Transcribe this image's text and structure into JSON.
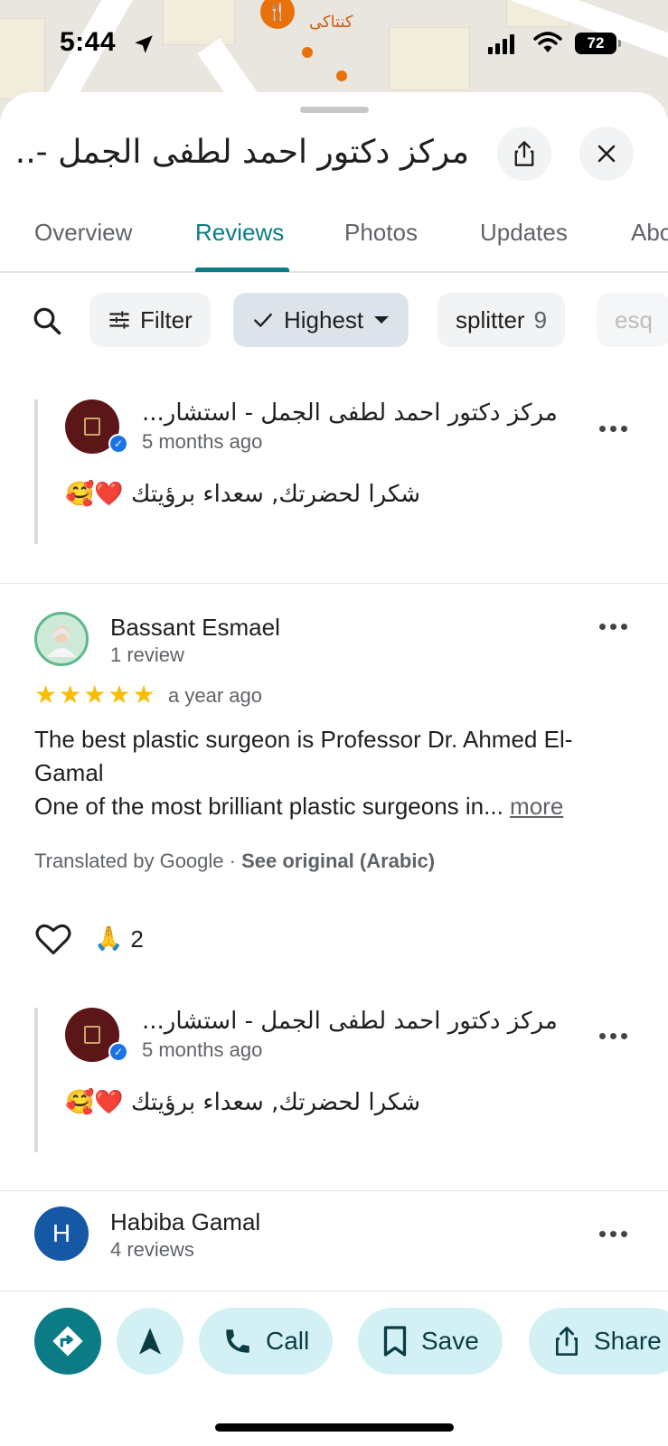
{
  "status_bar": {
    "time": "5:44",
    "battery": "72"
  },
  "map": {
    "poi_label": "كنتاكى"
  },
  "place": {
    "title": "مركز دكتور احمد لطفى الجمل -..."
  },
  "tabs": [
    {
      "label": "Overview"
    },
    {
      "label": "Reviews",
      "active": true
    },
    {
      "label": "Photos"
    },
    {
      "label": "Updates"
    },
    {
      "label": "Abo"
    }
  ],
  "filters": {
    "filter_label": "Filter",
    "sort_label": "Highest",
    "topics": [
      {
        "label": "splitter",
        "count": "9"
      },
      {
        "label": "esq"
      }
    ]
  },
  "reviews": [
    {
      "type": "owner_reply",
      "name": "مركز دكتور احمد لطفى الجمل - استشار...",
      "time": "5 months ago",
      "text": "شكرا لحضرتك, سعداء برؤيتك ❤️🥰"
    },
    {
      "type": "review",
      "name": "Bassant Esmael",
      "subtitle": "1 review",
      "rating": 5,
      "time": "a year ago",
      "text_line1": "The best plastic surgeon is Professor Dr. Ahmed El-Gamal",
      "text_line2": "One of the most brilliant plastic surgeons in...",
      "more_label": "more",
      "translated": "Translated by Google · ",
      "see_original": "See original (Arabic)",
      "reaction_emoji": "🙏",
      "reaction_count": "2"
    },
    {
      "type": "owner_reply",
      "name": "مركز دكتور احمد لطفى الجمل - استشار...",
      "time": "5 months ago",
      "text": "شكرا لحضرتك, سعداء برؤيتك ❤️🥰"
    },
    {
      "type": "review",
      "name": "Habiba Gamal",
      "subtitle": "4 reviews",
      "initial": "H"
    }
  ],
  "actions": {
    "call": "Call",
    "save": "Save",
    "share": "Share"
  },
  "colors": {
    "accent": "#0b7c86",
    "action_bg": "#d3f1f5",
    "star": "#fbbc04",
    "avatar_blue": "#1558a5"
  }
}
